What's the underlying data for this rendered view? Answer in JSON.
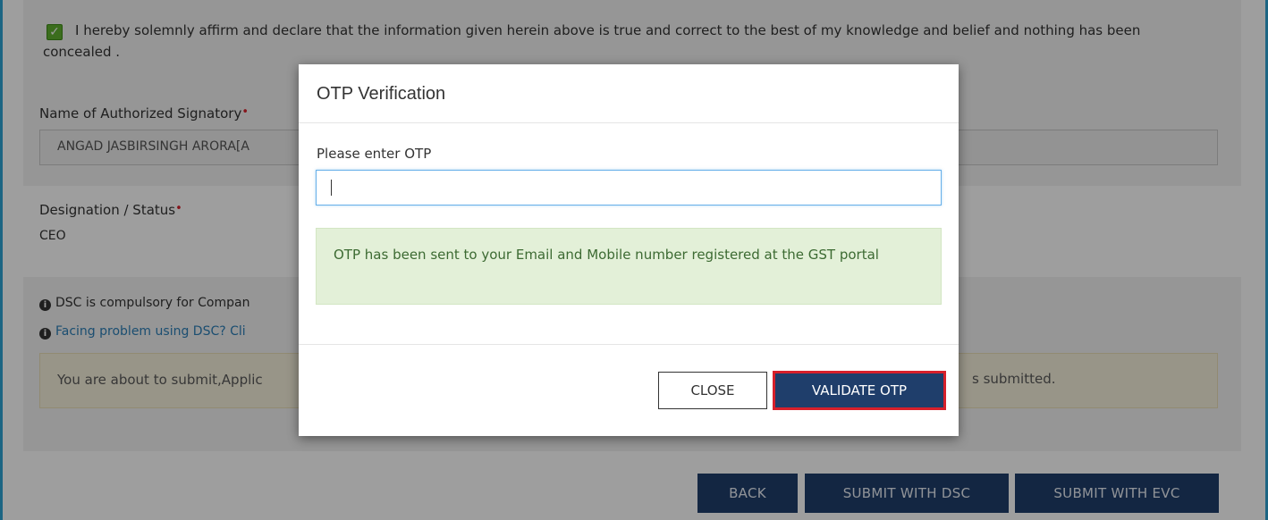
{
  "declaration": {
    "checked": true,
    "text": "I hereby solemnly affirm and declare that the information given herein above is true and correct to the best of my knowledge and belief and nothing has been concealed ."
  },
  "signatory": {
    "label": "Name of Authorized Signatory",
    "required_mark": "•",
    "value": "ANGAD JASBIRSINGH ARORA[A"
  },
  "designation": {
    "label": "Designation / Status",
    "required_mark": "•",
    "value": "CEO"
  },
  "info": {
    "dsc_notice": "DSC is compulsory for Compan",
    "dsc_help": "Facing problem using DSC? Cli"
  },
  "warning": {
    "text_start": "You are about to submit,Applic",
    "text_end": "s submitted."
  },
  "footer_buttons": {
    "back": "BACK",
    "submit_dsc": "SUBMIT WITH DSC",
    "submit_evc": "SUBMIT WITH EVC"
  },
  "modal": {
    "title": "OTP Verification",
    "otp_label": "Please enter OTP",
    "otp_value": "",
    "otp_message": "OTP has been sent to your Email and Mobile number registered at the GST portal",
    "close_label": "CLOSE",
    "validate_label": "VALIDATE OTP"
  },
  "colors": {
    "primary_button": "#1f3e6b",
    "highlight_border": "#d7202b",
    "success_bg": "#e3f0d8",
    "checkbox": "#5fb130"
  }
}
